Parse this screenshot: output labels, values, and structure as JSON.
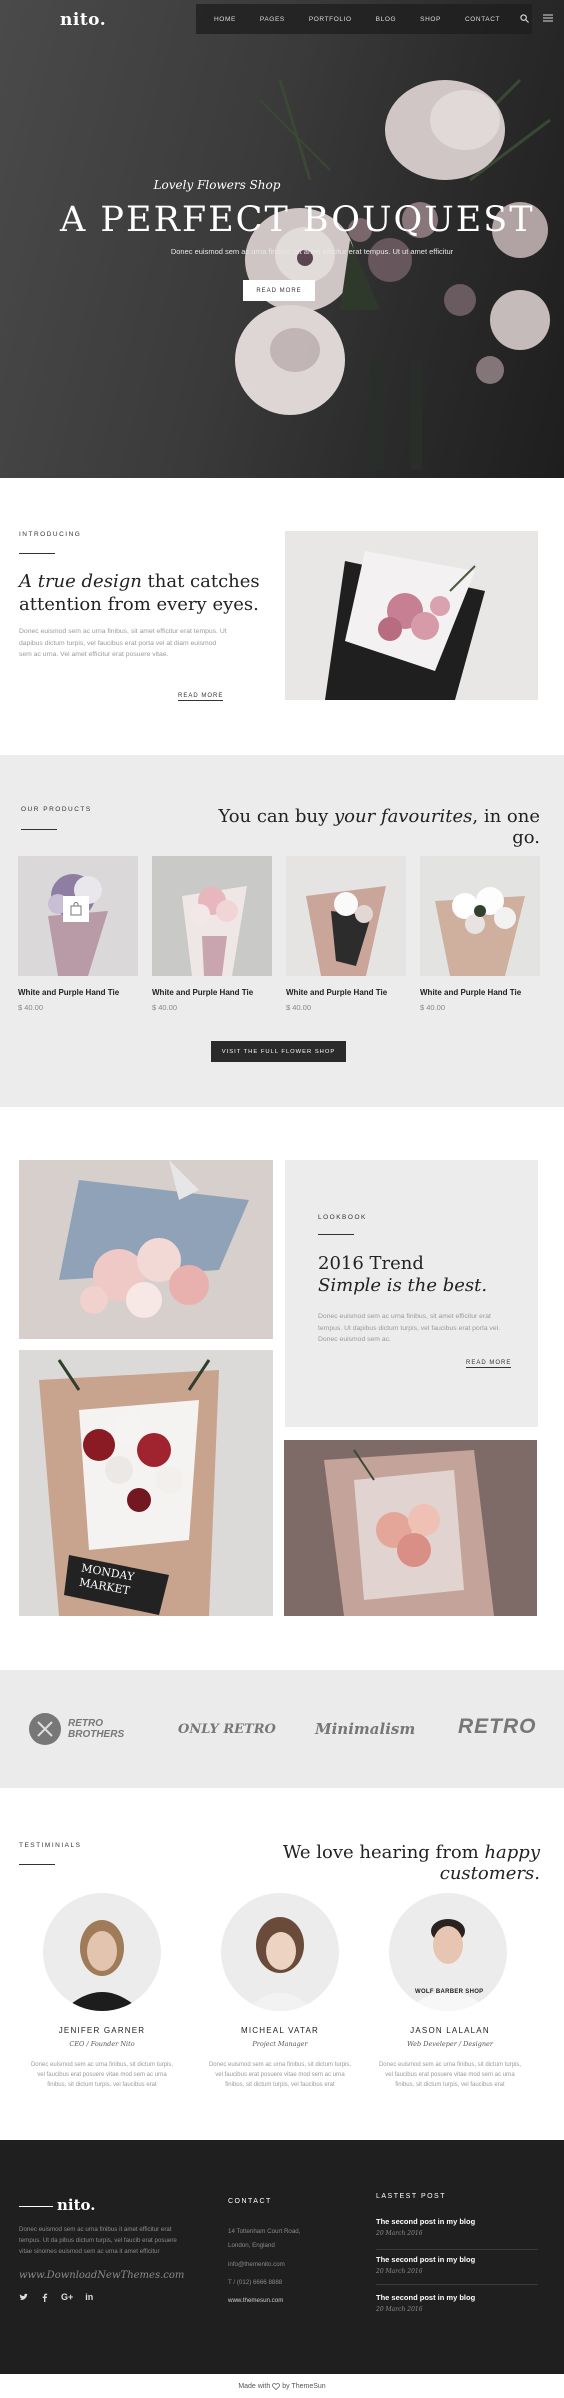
{
  "header": {
    "logo": "nito.",
    "nav": [
      "HOME",
      "PAGES",
      "PORTFOLIO",
      "BLOG",
      "SHOP",
      "CONTACT"
    ],
    "icons": [
      "search-icon",
      "menu-icon"
    ]
  },
  "hero": {
    "subtitle": "Lovely Flowers Shop",
    "title": "A PERFECT BOUQUEST",
    "description": "Donec euismod sem ac urna finibus, sit amet efficitur erat tempus. Ut ut amet efficitur",
    "button": "READ MORE"
  },
  "intro": {
    "eyebrow": "INTRODUCING",
    "heading_line1_em": "A true design",
    "heading_line1_rest": " that catches",
    "heading_line2": "attention from every eyes.",
    "body": "Donec euismod sem ac urna finibus, sit amet efficitur erat tempus. Ut dapibus dictum turpis, vel faucibus erat porta vel at diam euismod sem ac urna. Vel amet efficitur erat posuere vitae.",
    "link": "READ MORE"
  },
  "products": {
    "eyebrow": "OUR PRODUCTS",
    "heading_pre": "You can buy ",
    "heading_em": "your favourites",
    "heading_post": ", in one go.",
    "items": [
      {
        "name": "White and Purple Hand Tie",
        "price": "$ 40.00"
      },
      {
        "name": "White and Purple Hand Tie",
        "price": "$ 40.00"
      },
      {
        "name": "White and Purple Hand Tie",
        "price": "$ 40.00"
      },
      {
        "name": "White and Purple Hand Tie",
        "price": "$ 40.00"
      }
    ],
    "button": "VISIT THE FULL FLOWER SHOP"
  },
  "lookbook": {
    "eyebrow": "LOOKBOOK",
    "heading1": "2016 Trend",
    "heading2": "Simple is the best.",
    "body": "Donec euismod sem ac urna finibus, sit amet efficitur erat tempus. Ut dapibus dictum turpis, vel faucibus erat porta vel. Donec euismod sem ac.",
    "link": "READ MORE",
    "card_text1": "MONDAY",
    "card_text2": "MARKET"
  },
  "brands": {
    "items": [
      {
        "line1": "RETRO",
        "line2": "BROTHERS"
      },
      {
        "line1": "ONLY RETRO",
        "line2": ""
      },
      {
        "line1": "Minimalism",
        "line2": ""
      },
      {
        "line1": "RETRO",
        "line2": ""
      }
    ]
  },
  "testimonials": {
    "eyebrow": "TESTIMINIALS",
    "heading_pre": "We love hearing from ",
    "heading_em": "happy customers.",
    "people": [
      {
        "name": "JENIFER GARNER",
        "role": "CEO / Founder Nito",
        "quote": "Donec euismod sem ac urna finibus, sit dictum turpis, vel faucibus erat posuere vitae mod sem ac urna finibus, sit dictum turpis, vel faucibus erat"
      },
      {
        "name": "MICHEAL VATAR",
        "role": "Project Manager",
        "quote": "Donec euismod sem ac urna finibus, sit dictum turpis, vel faucibus erat posuere vitae mod sem ac urna finibus, sit dictum turpis, vel faucibus erat"
      },
      {
        "name": "JASON LALALAN",
        "role": "Web Develeper / Designer",
        "quote": "Donec euismod sem ac urna finibus, sit dictum turpis, vel faucibus erat posuere vitae mod sem ac urna finibus, sit dictum turpis, vel faucibus erat"
      }
    ],
    "shirt_text": "WOLF BARBER SHOP"
  },
  "footer": {
    "logo": "nito.",
    "about": "Donec euismod sem ac urna finibus it amet efficitur erat tempus. Ut da pibus dictum turpis, vel faucib erat posuere vitae sinomes euismod sem ac urna it amet efficitur",
    "watermark": "www.DownloadNewThemes.com",
    "social": [
      "twitter-icon",
      "facebook-icon",
      "google-plus-icon",
      "linkedin-icon"
    ],
    "contact_title": "CONTACT",
    "address1": "14 Tottenham Court Road,",
    "address2": "London, England",
    "email": "info@themenito.com",
    "phone": "T / (012) 6666 8888",
    "website": "www.themesun.com",
    "posts_title": "LASTEST POST",
    "posts": [
      {
        "title": "The second post in my blog",
        "date": "20 March 2016"
      },
      {
        "title": "The second post in my blog",
        "date": "20 March 2016"
      },
      {
        "title": "The second post in my blog",
        "date": "20 March 2016"
      }
    ],
    "credit_pre": "Made with ",
    "credit_post": " by ThemeSun"
  }
}
